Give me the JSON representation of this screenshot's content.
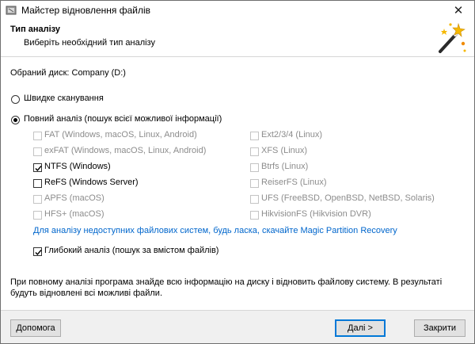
{
  "window": {
    "title": "Майстер відновлення файлів"
  },
  "header": {
    "title": "Тип аналізу",
    "subtitle": "Виберіть необхідний тип аналізу"
  },
  "selected_disk": "Обраний диск: Company (D:)",
  "scan_modes": {
    "quick": {
      "label": "Швидке сканування",
      "selected": false
    },
    "full": {
      "label": "Повний аналіз (пошук всієї можливої інформації)",
      "selected": true
    }
  },
  "filesystems_left": [
    {
      "label": "FAT (Windows, macOS, Linux, Android)",
      "checked": false,
      "enabled": false
    },
    {
      "label": "exFAT (Windows, macOS, Linux, Android)",
      "checked": false,
      "enabled": false
    },
    {
      "label": "NTFS (Windows)",
      "checked": true,
      "enabled": true
    },
    {
      "label": "ReFS (Windows Server)",
      "checked": false,
      "enabled": true
    },
    {
      "label": "APFS (macOS)",
      "checked": false,
      "enabled": false
    },
    {
      "label": "HFS+ (macOS)",
      "checked": false,
      "enabled": false
    }
  ],
  "filesystems_right": [
    {
      "label": "Ext2/3/4 (Linux)",
      "checked": false,
      "enabled": false
    },
    {
      "label": "XFS (Linux)",
      "checked": false,
      "enabled": false
    },
    {
      "label": "Btrfs (Linux)",
      "checked": false,
      "enabled": false
    },
    {
      "label": "ReiserFS (Linux)",
      "checked": false,
      "enabled": false
    },
    {
      "label": "UFS (FreeBSD, OpenBSD, NetBSD, Solaris)",
      "checked": false,
      "enabled": false
    },
    {
      "label": "HikvisionFS (Hikvision DVR)",
      "checked": false,
      "enabled": false
    }
  ],
  "partition_link": "Для аналізу недоступних файлових систем, будь ласка, скачайте Magic Partition Recovery",
  "deep_analysis": {
    "label": "Глибокий аналіз (пошук за вмістом файлів)",
    "checked": true
  },
  "info_text": "При повному аналізі програма знайде всю інформацію на диску і відновить файлову систему. В результаті будуть відновлені всі можливі файли.",
  "buttons": {
    "help": "Допомога",
    "next": "Далі >",
    "close": "Закрити"
  },
  "icons": {
    "app": "app-icon",
    "wizard": "magic-wand-icon",
    "close": "close-icon",
    "checkmark": "checkmark-icon"
  }
}
